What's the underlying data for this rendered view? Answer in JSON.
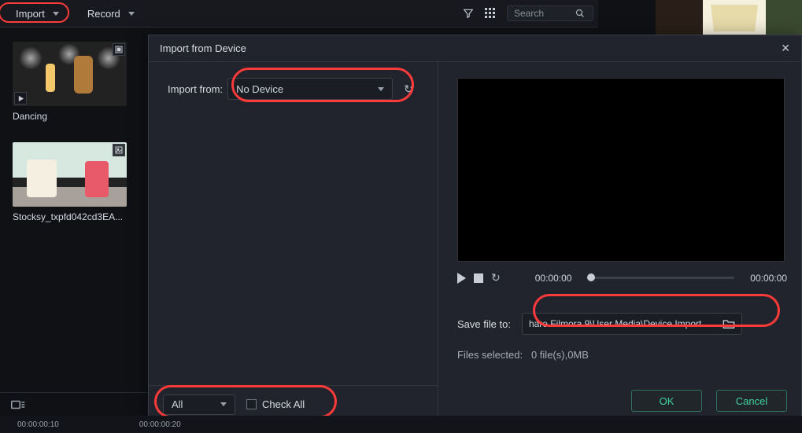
{
  "toolbar": {
    "import_label": "Import",
    "record_label": "Record",
    "search_placeholder": "Search"
  },
  "media": {
    "items": [
      {
        "name": "Dancing"
      },
      {
        "name": "Stocksy_txpfd042cd3EA..."
      }
    ]
  },
  "dialog": {
    "title": "Import from Device",
    "import_from_label": "Import from:",
    "device_selected": "No Device",
    "filter_selected": "All",
    "check_all_label": "Check All",
    "preview": {
      "time_current": "00:00:00",
      "time_total": "00:00:00"
    },
    "save_label": "Save file to:",
    "save_path": "hare Filmora 9\\User Media\\Device Import",
    "files_selected_label": "Files selected:",
    "files_selected_value": "0 file(s),0MB",
    "ok_label": "OK",
    "cancel_label": "Cancel"
  },
  "timeline": {
    "t0": "00:00:00:10",
    "t1": "00:00:00:20"
  }
}
